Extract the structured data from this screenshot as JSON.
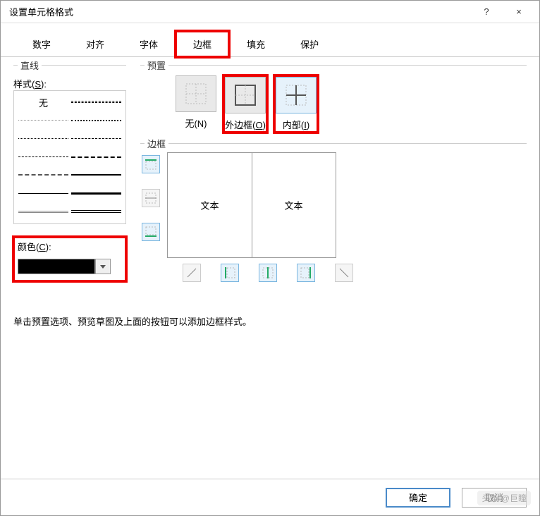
{
  "window": {
    "title": "设置单元格格式",
    "help": "?",
    "close": "×"
  },
  "tabs": [
    "数字",
    "对齐",
    "字体",
    "边框",
    "填充",
    "保护"
  ],
  "active_tab_index": 3,
  "line": {
    "section": "直线",
    "style_label": "样式(S):",
    "none": "无",
    "color_label": "颜色(C):"
  },
  "preset": {
    "section": "预置",
    "items": [
      {
        "label": "无(N)"
      },
      {
        "label": "外边框(O)"
      },
      {
        "label": "内部(I)"
      }
    ]
  },
  "border": {
    "section": "边框",
    "sample_text": "文本"
  },
  "hint": "单击预置选项、预览草图及上面的按钮可以添加边框样式。",
  "footer": {
    "ok": "确定",
    "cancel": "取消"
  },
  "watermark": "头条 @巨瞳"
}
